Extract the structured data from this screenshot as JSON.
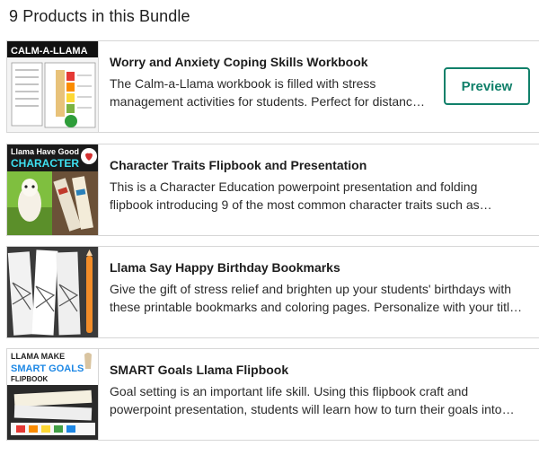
{
  "bundle": {
    "heading": "9 Products in this Bundle"
  },
  "products": [
    {
      "title": "Worry and Anxiety Coping Skills Workbook",
      "description": "The Calm-a-Llama workbook is filled with stress management activities for students. Perfect for distance learning and classroom use.",
      "thumb_text": "CALM-A-LLAMA",
      "preview_label": "Preview"
    },
    {
      "title": "Character Traits Flipbook and Presentation",
      "description": "This is a Character Education powerpoint presentation and folding flipbook introducing 9 of the most common character traits such as respect, responsibility and more.",
      "thumb_text_line1": "Llama Have Good",
      "thumb_text_line2": "CHARACTER"
    },
    {
      "title": "Llama Say Happy Birthday Bookmarks",
      "description": "Give the gift of stress relief and brighten up your students' birthdays with these printable bookmarks and coloring pages. Personalize with your title and message."
    },
    {
      "title": "SMART Goals Llama Flipbook",
      "description": "Goal setting is an important life skill. Using this flipbook craft and powerpoint presentation, students will learn how to turn their goals into reality.",
      "thumb_text_line1": "LLAMA MAKE",
      "thumb_text_line2": "SMART GOALS",
      "thumb_text_line3": "FLIPBOOK"
    }
  ],
  "colors": {
    "accent": "#11806a",
    "border": "#d6d6d6"
  }
}
